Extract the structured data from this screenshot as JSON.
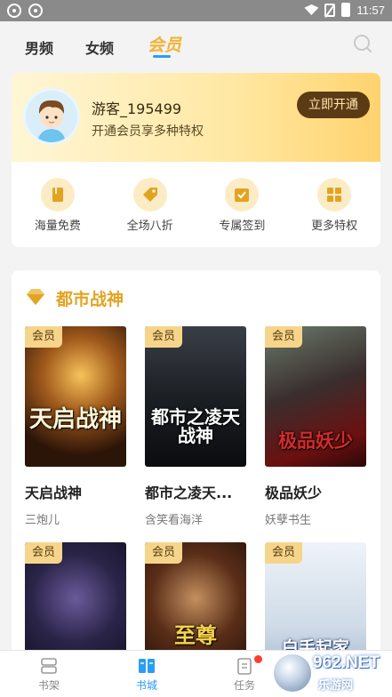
{
  "status_bar": {
    "time": "11:57"
  },
  "header": {
    "tabs": [
      {
        "label": "男频"
      },
      {
        "label": "女频"
      },
      {
        "label": "会员",
        "active": true
      }
    ]
  },
  "member": {
    "username": "游客_195499",
    "subtitle": "开通会员享多种特权",
    "open_button": "立即开通",
    "perks": [
      {
        "label": "海量免费",
        "icon": "book-icon"
      },
      {
        "label": "全场八折",
        "icon": "discount-tag-icon"
      },
      {
        "label": "专属签到",
        "icon": "checkin-icon"
      },
      {
        "label": "更多特权",
        "icon": "grid-icon"
      }
    ]
  },
  "section": {
    "title": "都市战神",
    "badge": "会员",
    "books": [
      {
        "name": "天启战神",
        "author": "三炮儿",
        "cover_title": "天启战神"
      },
      {
        "name": "都市之凌天...",
        "author": "含笑看海洋",
        "cover_title": "都市之凌天战神"
      },
      {
        "name": "极品妖少",
        "author": "妖孽书生",
        "cover_title": "极品妖少"
      },
      {
        "name": "",
        "author": "",
        "cover_title": ""
      },
      {
        "name": "",
        "author": "",
        "cover_title": "至尊"
      },
      {
        "name": "",
        "author": "",
        "cover_title": "白手起家"
      }
    ]
  },
  "bottom_nav": {
    "items": [
      {
        "label": "书架"
      },
      {
        "label": "书城",
        "active": true
      },
      {
        "label": "任务"
      }
    ]
  },
  "watermark": {
    "text": "962.NET",
    "sub": "乐游网"
  },
  "colors": {
    "accent": "#2a9df4",
    "gold": "#e3a322",
    "vip_brown": "#5b3b14"
  }
}
